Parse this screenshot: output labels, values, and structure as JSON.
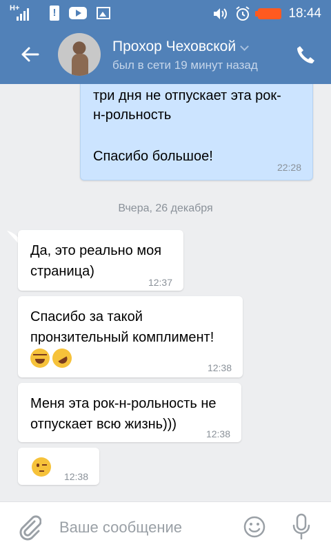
{
  "status_bar": {
    "time": "18:44",
    "signal_label": "H+",
    "icons": [
      "signal-icon",
      "alert-icon",
      "youtube-icon",
      "image-icon",
      "volume-icon",
      "alarm-icon",
      "battery-icon"
    ],
    "battery_color": "#ff5a1f"
  },
  "header": {
    "contact_name": "Прохор Чеховской",
    "last_seen": "был в сети 19 минут назад",
    "background_color": "#5181b8"
  },
  "messages": [
    {
      "direction": "outgoing",
      "lines": [
        "три дня не отпускает эта рок-",
        "н-рольность",
        "",
        "Спасибо большое!"
      ],
      "time": "22:28"
    },
    {
      "direction": "incoming",
      "lines": [
        "Да, это реально моя",
        "страница)"
      ],
      "time": "12:37"
    },
    {
      "direction": "incoming",
      "lines": [
        "Спасибо за такой",
        "пронзительный комплимент!"
      ],
      "emojis": [
        "face-with-tears-of-joy",
        "rolling-on-floor-laughing"
      ],
      "time": "12:38"
    },
    {
      "direction": "incoming",
      "lines": [
        "Меня эта рок-н-рольность не",
        "отпускает всю жизнь)))"
      ],
      "time": "12:38"
    },
    {
      "direction": "incoming",
      "emojis": [
        "winking-face"
      ],
      "time": "12:38"
    }
  ],
  "date_separator": "Вчера, 26 декабря",
  "composer": {
    "placeholder": "Ваше сообщение"
  }
}
